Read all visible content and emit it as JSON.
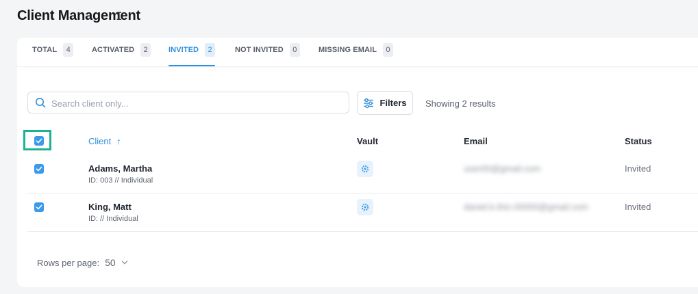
{
  "header": {
    "title": "Client Management"
  },
  "tabs": [
    {
      "label": "TOTAL",
      "count": "4"
    },
    {
      "label": "ACTIVATED",
      "count": "2"
    },
    {
      "label": "INVITED",
      "count": "2",
      "active": true
    },
    {
      "label": "NOT INVITED",
      "count": "0"
    },
    {
      "label": "MISSING EMAIL",
      "count": "0"
    }
  ],
  "search": {
    "placeholder": "Search client only...",
    "value": ""
  },
  "filters": {
    "label": "Filters"
  },
  "results": {
    "text": "Showing 2 results"
  },
  "table": {
    "columns": {
      "client": "Client",
      "vault": "Vault",
      "email": "Email",
      "status": "Status"
    },
    "sort_icon": "arrow-up-icon",
    "rows": [
      {
        "name": "Adams, Martha",
        "sub": "ID: 003 // Individual",
        "email": "user00@gmail.com",
        "status": "Invited",
        "checked": true
      },
      {
        "name": "King, Matt",
        "sub": "ID: // Individual",
        "email": "daniel.k.thin.00000@gmail.com",
        "status": "Invited",
        "checked": true
      }
    ]
  },
  "pagination": {
    "rows_per_page_label": "Rows per page:",
    "rows_per_page_value": "50"
  },
  "colors": {
    "accent": "#2f8fdc",
    "checkbox": "#3b9aea",
    "focus": "#1ab394"
  }
}
